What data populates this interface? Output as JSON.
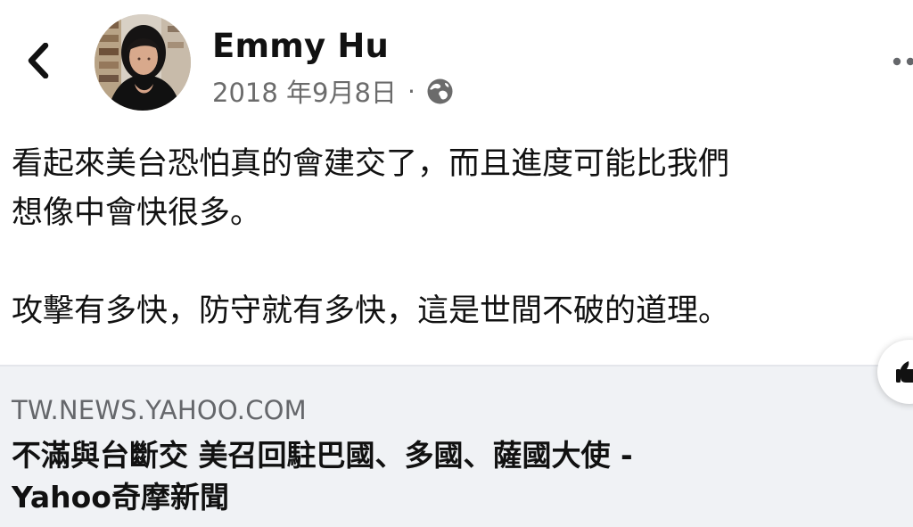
{
  "post": {
    "author_name": "Emmy Hu",
    "timestamp": "2018 年9月8日",
    "separator": "·",
    "privacy_icon": "globe-icon",
    "back_icon": "chevron-left-icon",
    "more_icon": "more-options-icon",
    "body_lines": [
      "看起來美台恐怕真的會建交了，而且進度可能比我們",
      "想像中會快很多。",
      "攻擊有多快，防守就有多快，這是世間不破的道理。"
    ]
  },
  "link_preview": {
    "domain": "TW.NEWS.YAHOO.COM",
    "title_lines": [
      "不滿與台斷交 美召回駐巴國、多國、薩國大使 -",
      "Yahoo奇摩新聞"
    ]
  },
  "colors": {
    "text_primary": "#111111",
    "text_secondary": "#65676b",
    "preview_background": "#f0f2f5"
  }
}
